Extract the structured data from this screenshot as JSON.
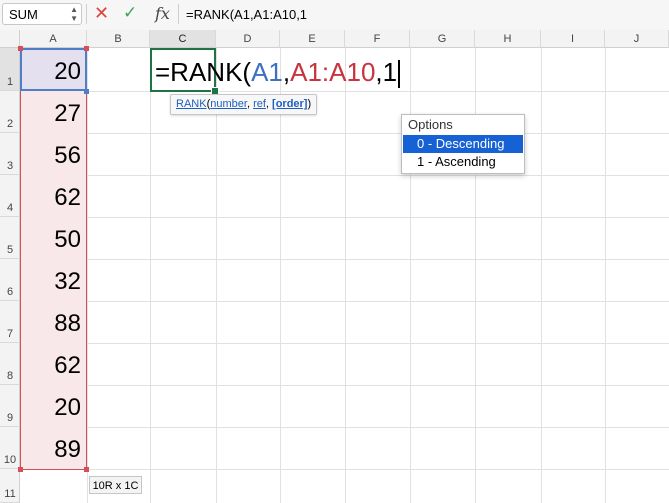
{
  "formula_bar": {
    "name_box": "SUM",
    "cancel_icon": "x-icon",
    "confirm_icon": "check-icon",
    "function_label": "fx",
    "formula": "=RANK(A1,A1:A10,1"
  },
  "columns": [
    "A",
    "B",
    "C",
    "D",
    "E",
    "F",
    "G",
    "H",
    "I",
    "J"
  ],
  "rows": [
    "1",
    "2",
    "3",
    "4",
    "5",
    "6",
    "7",
    "8",
    "9",
    "10",
    "11"
  ],
  "cells": {
    "A": [
      "20",
      "27",
      "56",
      "62",
      "50",
      "32",
      "88",
      "62",
      "20",
      "89"
    ]
  },
  "editor": {
    "prefix": "=RANK(",
    "ref1": "A1",
    "comma1": ",",
    "ref2": "A1:A10",
    "comma2": ",",
    "arg3": "1"
  },
  "tooltip": {
    "function": "RANK",
    "open": "(",
    "arg1": "number",
    "sep1": ", ",
    "arg2": "ref",
    "sep2": ", ",
    "arg3": "[order]",
    "close": ")"
  },
  "options": {
    "title": "Options",
    "items": [
      "0 - Descending",
      "1 - Ascending"
    ],
    "selected_index": 0
  },
  "selection_size": "10R x 1C",
  "colors": {
    "ref1": "#3b70c2",
    "ref2": "#c9333f",
    "active_cell": "#217346",
    "option_selected": "#1662d4"
  }
}
